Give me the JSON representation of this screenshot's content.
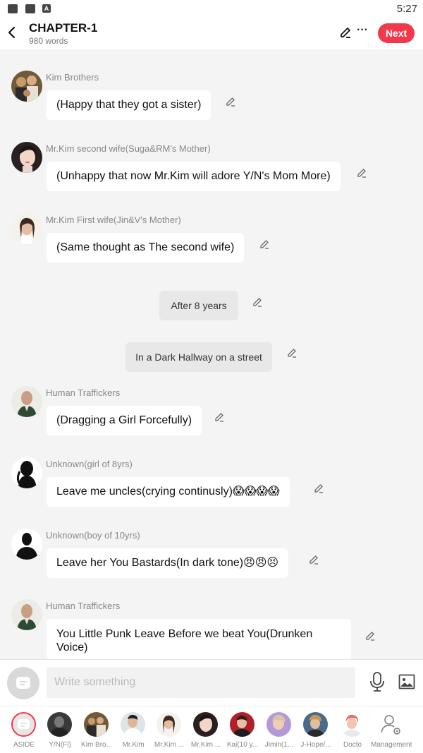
{
  "status_bar": {
    "time": "5:27",
    "icons": [
      "image-icon",
      "folder-icon",
      "a-icon"
    ]
  },
  "header": {
    "title": "CHAPTER-1",
    "word_count": "980 words",
    "next_label": "Next",
    "more_label": "···"
  },
  "messages": [
    {
      "sender": "Kim Brothers",
      "text": "(Happy that they got a sister)"
    },
    {
      "sender": "Mr.Kim second wife(Suga&RM's Mother)",
      "text": "(Unhappy that now Mr.Kim will adore Y/N's Mom More)"
    },
    {
      "sender": "Mr.Kim First wife(Jin&V's Mother)",
      "text": "(Same thought as The second wife)"
    },
    {
      "sender": "Human Traffickers",
      "text": "(Dragging a Girl Forcefully)"
    },
    {
      "sender": "Unknown(girl of 8yrs)",
      "text": "Leave me uncles(crying continusly)😱😱😱😱"
    },
    {
      "sender": "Unknown(boy of 10yrs)",
      "text": "Leave her You Bastards(In dark tone)😠😠😣"
    },
    {
      "sender": "Human Traffickers",
      "text": "You Little Punk Leave Before we beat You(Drunken Voice)"
    }
  ],
  "notes": [
    {
      "text": "After 8 years"
    },
    {
      "text": "In a Dark Hallway on a street"
    }
  ],
  "input": {
    "placeholder": "Write something"
  },
  "characters": [
    {
      "label": "ASIDE"
    },
    {
      "label": "Y/N(Fl)"
    },
    {
      "label": "Kim Bro..."
    },
    {
      "label": "Mr.Kim"
    },
    {
      "label": "Mr.Kim ..."
    },
    {
      "label": "Mr.Kim ..."
    },
    {
      "label": "Kai(10 y..."
    },
    {
      "label": "Jimin(1..."
    },
    {
      "label": "J-Hope/..."
    },
    {
      "label": "Docto"
    },
    {
      "label": "Management"
    }
  ],
  "colors": {
    "accent": "#f2394c",
    "background": "#f4f4f4",
    "bubble": "#ffffff",
    "note": "#e8e8e8"
  }
}
